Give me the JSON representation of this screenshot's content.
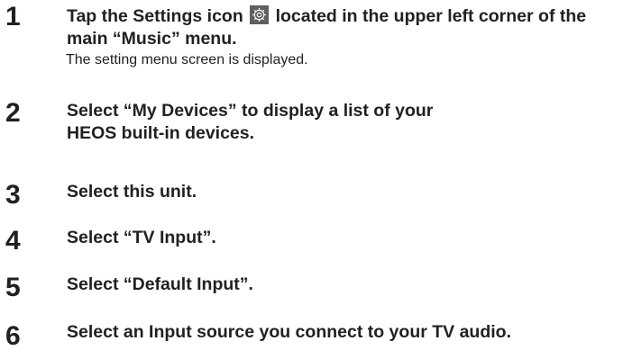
{
  "steps": [
    {
      "number": "1",
      "text_before_icon": "Tap the Settings icon ",
      "icon": "settings-gear-icon",
      "text_after_icon": " located in the upper left corner of the main “Music” menu.",
      "note": "The setting menu screen is displayed."
    },
    {
      "number": "2",
      "text": "Select “My Devices” to display a list of your HEOS built-in devices."
    },
    {
      "number": "3",
      "text": "Select this unit."
    },
    {
      "number": "4",
      "text": "Select “TV Input”."
    },
    {
      "number": "5",
      "text": "Select “Default Input”."
    },
    {
      "number": "6",
      "text": "Select an Input source you connect to your TV audio."
    }
  ],
  "colors": {
    "text": "#231f20",
    "icon_background": "#5f6062",
    "icon_foreground": "#ffffff"
  }
}
